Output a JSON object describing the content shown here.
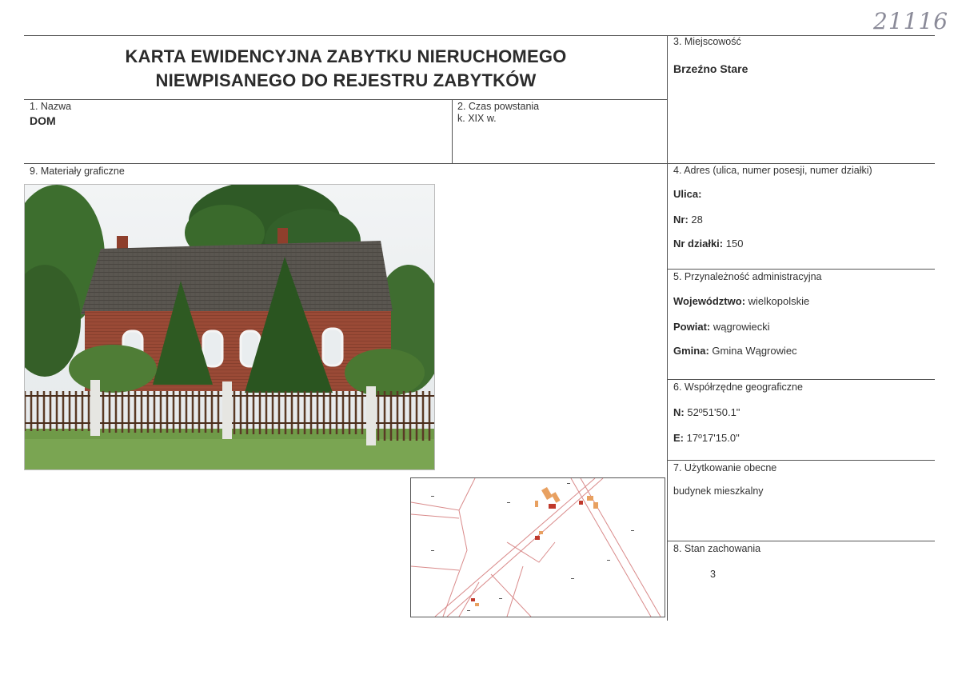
{
  "handwritten_number": "21116",
  "title_line1": "KARTA EWIDENCYJNA ZABYTKU NIERUCHOMEGO",
  "title_line2": "NIEWPISANEGO DO REJESTRU ZABYTKÓW",
  "field1": {
    "label": "1. Nazwa",
    "value": "DOM"
  },
  "field2": {
    "label": "2. Czas powstania",
    "value": "k. XIX w."
  },
  "field3": {
    "label": "3. Miejscowość",
    "value": "Brzeźno Stare"
  },
  "field4": {
    "label": "4. Adres (ulica, numer posesji, numer działki)",
    "ulica_label": "Ulica:",
    "ulica_value": "",
    "nr_label": "Nr:",
    "nr_value": "28",
    "dzialka_label": "Nr działki:",
    "dzialka_value": "150"
  },
  "field5": {
    "label": "5. Przynależność administracyjna",
    "woj_label": "Województwo:",
    "woj_value": "wielkopolskie",
    "powiat_label": "Powiat:",
    "powiat_value": "wągrowiecki",
    "gmina_label": "Gmina:",
    "gmina_value": "Gmina Wągrowiec"
  },
  "field6": {
    "label": "6. Współrzędne geograficzne",
    "n_label": "N:",
    "n_value": "52º51'50.1\"",
    "e_label": "E:",
    "e_value": "17º17'15.0\""
  },
  "field7": {
    "label": "7. Użytkowanie obecne",
    "value": "budynek mieszkalny"
  },
  "field8": {
    "label": "8. Stan zachowania",
    "value": "3"
  },
  "field9": {
    "label": "9. Materiały graficzne"
  },
  "colors": {
    "line": "#555555",
    "map_line": "#d98a8a",
    "building_red": "#c0392b",
    "building_orange": "#e8a060"
  }
}
